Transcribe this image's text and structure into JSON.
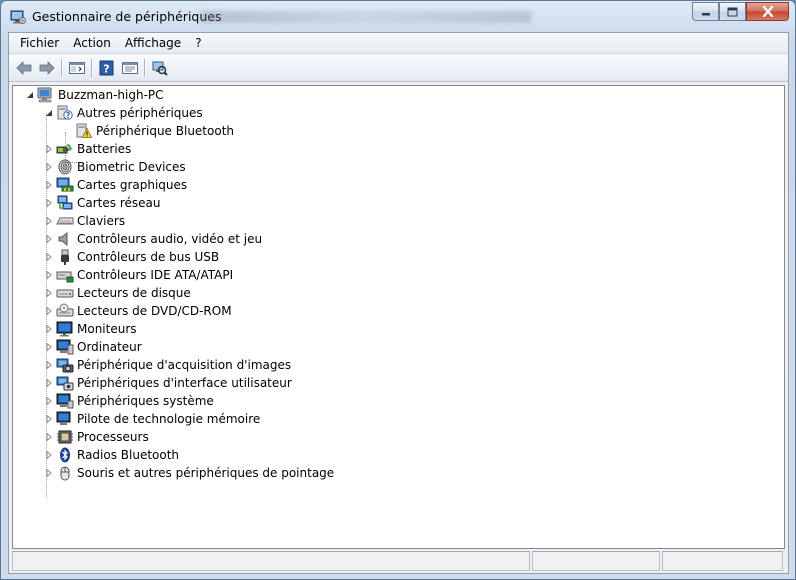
{
  "window": {
    "title": "Gestionnaire de périphériques",
    "minimize_label": "▁",
    "maximize_label": "▫",
    "close_label": "✕"
  },
  "menu": [
    {
      "label": "Fichier"
    },
    {
      "label": "Action"
    },
    {
      "label": "Affichage"
    },
    {
      "label": "?"
    }
  ],
  "toolbar": {
    "buttons": [
      {
        "icon": "back-arrow-icon"
      },
      {
        "icon": "forward-arrow-icon"
      },
      {
        "icon": "show-hide-console-tree-icon"
      },
      {
        "icon": "help-icon"
      },
      {
        "icon": "properties-pane-icon"
      },
      {
        "icon": "scan-hardware-icon"
      }
    ]
  },
  "tree": {
    "root": {
      "label": "Buzzman-high-PC",
      "icon": "computer-icon",
      "expanded": true
    },
    "items": [
      {
        "label": "Autres périphériques",
        "icon": "unknown-device-icon",
        "expanded": true,
        "children": [
          {
            "label": "Périphérique Bluetooth",
            "icon": "warning-device-icon"
          }
        ]
      },
      {
        "label": "Batteries",
        "icon": "battery-icon",
        "expanded": false
      },
      {
        "label": "Biometric Devices",
        "icon": "fingerprint-icon",
        "expanded": false
      },
      {
        "label": "Cartes graphiques",
        "icon": "display-adapter-icon",
        "expanded": false
      },
      {
        "label": "Cartes réseau",
        "icon": "network-adapter-icon",
        "expanded": false
      },
      {
        "label": "Claviers",
        "icon": "keyboard-icon",
        "expanded": false
      },
      {
        "label": "Contrôleurs audio, vidéo et jeu",
        "icon": "speaker-icon",
        "expanded": false
      },
      {
        "label": "Contrôleurs de bus USB",
        "icon": "usb-plug-icon",
        "expanded": false
      },
      {
        "label": "Contrôleurs IDE ATA/ATAPI",
        "icon": "ide-controller-icon",
        "expanded": false
      },
      {
        "label": "Lecteurs de disque",
        "icon": "disk-drive-icon",
        "expanded": false
      },
      {
        "label": "Lecteurs de DVD/CD-ROM",
        "icon": "dvd-drive-icon",
        "expanded": false
      },
      {
        "label": "Moniteurs",
        "icon": "monitor-icon",
        "expanded": false
      },
      {
        "label": "Ordinateur",
        "icon": "computer-icon",
        "expanded": false
      },
      {
        "label": "Périphérique d'acquisition d'images",
        "icon": "camera-icon",
        "expanded": false
      },
      {
        "label": "Périphériques d'interface utilisateur",
        "icon": "hid-icon",
        "expanded": false
      },
      {
        "label": "Périphériques système",
        "icon": "system-device-icon",
        "expanded": false
      },
      {
        "label": "Pilote de technologie mémoire",
        "icon": "memory-technology-icon",
        "expanded": false
      },
      {
        "label": "Processeurs",
        "icon": "processor-icon",
        "expanded": false
      },
      {
        "label": "Radios Bluetooth",
        "icon": "bluetooth-icon",
        "expanded": false
      },
      {
        "label": "Souris et autres périphériques de pointage",
        "icon": "mouse-icon",
        "expanded": false
      }
    ]
  },
  "statusbar": {
    "cells": [
      "",
      "",
      ""
    ]
  }
}
